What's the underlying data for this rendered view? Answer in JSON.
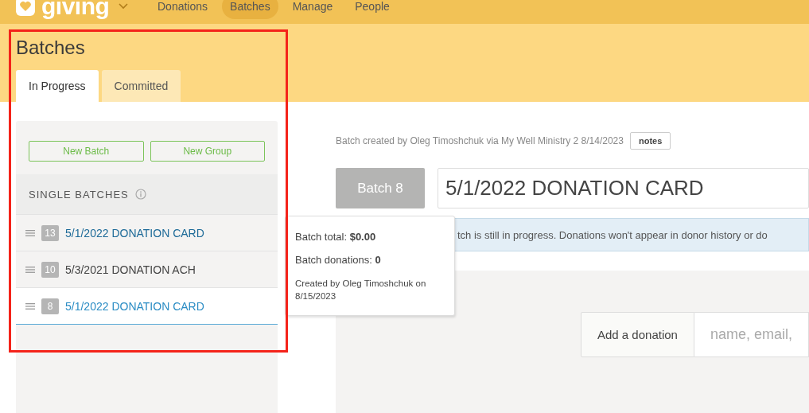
{
  "nav": {
    "brand": "giving",
    "items": [
      {
        "label": "Donations",
        "selected": false
      },
      {
        "label": "Batches",
        "selected": true
      },
      {
        "label": "Manage",
        "selected": false
      },
      {
        "label": "People",
        "selected": false
      }
    ]
  },
  "page_title": "Batches",
  "tabs": [
    {
      "label": "In Progress",
      "selected": true
    },
    {
      "label": "Committed",
      "selected": false
    }
  ],
  "sidebar": {
    "buttons": [
      "New Batch",
      "New Group"
    ],
    "section_title": "SINGLE BATCHES",
    "batches": [
      {
        "number": "13",
        "name": "5/1/2022 DONATION CARD",
        "hovered": true,
        "selected": false
      },
      {
        "number": "10",
        "name": "5/3/2021 DONATION ACH",
        "hovered": false,
        "selected": false
      },
      {
        "number": "8",
        "name": "5/1/2022 DONATION CARD",
        "hovered": false,
        "selected": true
      }
    ]
  },
  "tooltip": {
    "total": "Batch total: **$0.00**",
    "donations": "Batch donations: **0**",
    "created": "Created by Oleg Timoshchuk on 8/15/2023"
  },
  "main": {
    "meta": "Batch created by Oleg Timoshchuk via My Well Ministry 2 8/14/2023",
    "notes_button": "notes",
    "batch_label": "Batch 8",
    "title_value": "5/1/2022 DONATION CARD",
    "banner": "tch is still in progress. Donations won't appear in donor history or do",
    "add_donation": {
      "label": "Add a donation",
      "placeholder": "name, email,"
    }
  }
}
